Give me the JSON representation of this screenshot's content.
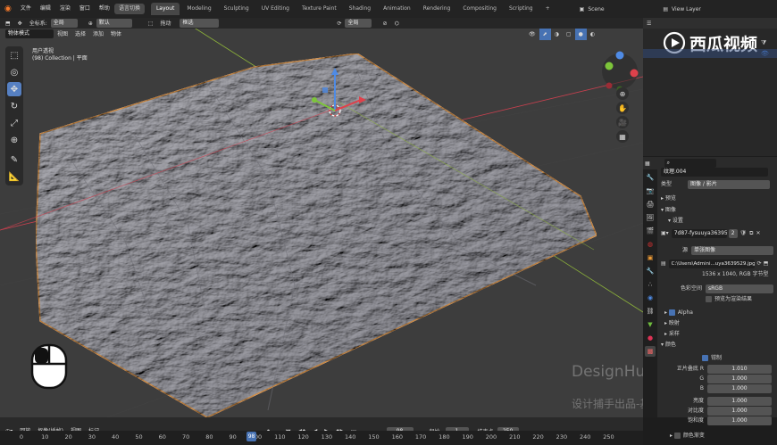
{
  "topbar": {
    "menus": [
      "文件",
      "编辑",
      "渲染",
      "窗口",
      "帮助"
    ],
    "switch_label": "语言切换",
    "workspaces": [
      "Layout",
      "Modeling",
      "Sculpting",
      "UV Editing",
      "Texture Paint",
      "Shading",
      "Animation",
      "Rendering",
      "Compositing",
      "Scripting"
    ],
    "scene": "Scene",
    "view_layer": "View Layer"
  },
  "tool_header": {
    "coord_label": "全局",
    "coord_prefix": "全标系:",
    "pivot": "默认",
    "drag_label": "拖动",
    "select_mode": "框选",
    "orientation": "全局"
  },
  "viewport_header": {
    "mode": "物体模式",
    "menus": [
      "视图",
      "选择",
      "添加",
      "物体"
    ]
  },
  "viewport": {
    "view_name": "用户透视",
    "collection": "(98) Collection | 平面"
  },
  "properties": {
    "search_placeholder": "",
    "texture_name": "纹理.004",
    "type_label": "类型",
    "type_value": "图像 / 影片",
    "preview": "预览",
    "image": "图像",
    "settings": "设置",
    "image_name": "7d87-fysuuya36395...",
    "users": "2",
    "source_label": "源",
    "source_value": "单张图像",
    "filepath": "C:\\Users\\Admini...uya3639529.jpg",
    "resolution": "1536 x 1040, RGB 字节型",
    "colorspace_label": "色彩空间",
    "colorspace_value": "sRGB",
    "view_as_render": "预览为渲染结果",
    "alpha": "Alpha",
    "mapping": "映射",
    "sampling": "采样",
    "colors": "颜色",
    "clamp": "钳制",
    "rgb_multiply": "正片叠底 R",
    "g": "G",
    "b": "B",
    "r_value": "1.010",
    "g_value": "1.000",
    "b_value": "1.000",
    "brightness": "亮度",
    "brightness_value": "1.000",
    "contrast": "对比度",
    "contrast_value": "1.000",
    "saturation": "饱和度",
    "saturation_value": "1.000",
    "color_ramp": "颜色渐变"
  },
  "timeline": {
    "playback": "回放",
    "keying": "抠像(插帧)",
    "view": "视图",
    "marker": "标记",
    "current_frame": "98",
    "start_label": "起始",
    "start": "1",
    "end_label": "结束点",
    "end": "250",
    "ticks": [
      "0",
      "10",
      "20",
      "30",
      "40",
      "50",
      "60",
      "70",
      "80",
      "90",
      "100",
      "110",
      "120",
      "130",
      "140",
      "150",
      "160",
      "170",
      "180",
      "190",
      "200",
      "210",
      "220",
      "230",
      "240",
      "250"
    ],
    "playhead": "98"
  },
  "watermarks": {
    "logo": "西瓜视频",
    "brand": "DesignHunting",
    "caption": "设计捕手出品-基础部分"
  },
  "colors": {
    "accent": "#4772b3",
    "outline": "#f3a44c",
    "x_axis": "#c9404f",
    "y_axis": "#8db33a"
  }
}
